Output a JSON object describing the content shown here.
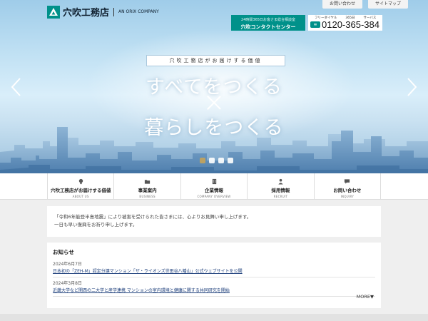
{
  "header": {
    "logo_name": "穴吹工務店",
    "logo_sub": "AN ORIX COMPANY",
    "toplinks": [
      "お問い合わせ",
      "サイトマップ"
    ],
    "contact_small": "24時間365日お客さま総合相談室",
    "contact_big": "穴吹コンタクトセンター",
    "freedial_labels": [
      "フリーダイヤル",
      "365日",
      "サーバス"
    ],
    "freedial_icon": "fd",
    "freedial_number": "0120-365-384"
  },
  "hero": {
    "tag": "穴吹工務店がお届けする価値",
    "headline_1": "すべてをつくる",
    "headline_2": "暮らしをつくる",
    "slides": 4,
    "active_slide": 1,
    "prev_icon": "chevron-left-icon",
    "next_icon": "chevron-right-icon"
  },
  "nav": {
    "items": [
      {
        "label": "穴吹工務店がお届けする価値",
        "sub": "ABOUT US",
        "icon": "lightbulb-icon"
      },
      {
        "label": "事業案内",
        "sub": "BUSINESS",
        "icon": "folder-icon"
      },
      {
        "label": "企業情報",
        "sub": "COMPANY OVERVIEW",
        "icon": "building-icon"
      },
      {
        "label": "採用情報",
        "sub": "RECRUIT",
        "icon": "person-icon"
      },
      {
        "label": "お問い合わせ",
        "sub": "INQUIRY",
        "icon": "chat-icon"
      }
    ]
  },
  "notice": {
    "line1": "「令和6年能登半島地震」により被害を受けられた皆さまには、心よりお見舞い申し上げます。",
    "line2": "一日も早い復興をお祈り申し上げます。"
  },
  "news": {
    "title": "お知らせ",
    "items": [
      {
        "date": "2024年6月7日",
        "text": "日本初の「ZEH-M」認定分譲マンション「ザ・ライオンズ世田谷八幡山」公式ウェブサイトを公開"
      },
      {
        "date": "2024年3月8日",
        "text": "近畿大学など関西の二大学と産学連携 マンションの室内環境と健康に関する共同研究を開始"
      }
    ],
    "more": "MORE▼"
  },
  "colors": {
    "brand_teal": "#00918a",
    "accent_gold": "#c5a35a"
  }
}
